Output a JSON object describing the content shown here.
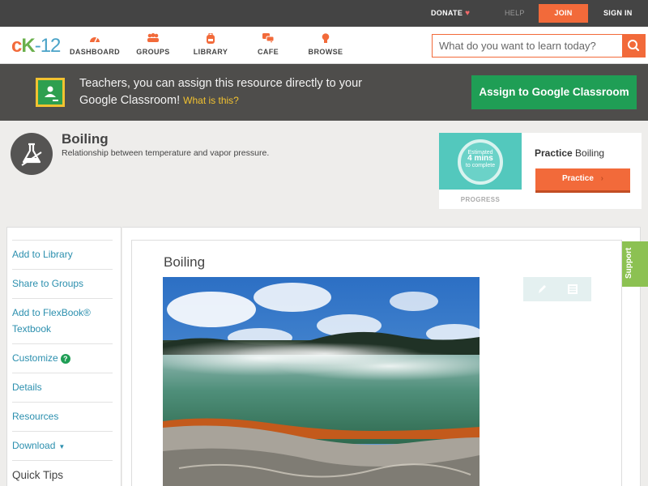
{
  "topbar": {
    "donate": "DONATE",
    "help": "HELP",
    "join": "JOIN",
    "signin": "SIGN IN"
  },
  "nav": {
    "logo": {
      "c": "c",
      "k": "K",
      "n": "-12"
    },
    "items": [
      {
        "label": "DASHBOARD",
        "icon": "dashboard-gauge-icon"
      },
      {
        "label": "GROUPS",
        "icon": "groups-people-icon"
      },
      {
        "label": "LIBRARY",
        "icon": "library-backpack-icon"
      },
      {
        "label": "CAFE",
        "icon": "cafe-chat-bubbles-icon"
      },
      {
        "label": "BROWSE",
        "icon": "browse-lightbulb-icon"
      }
    ],
    "search_placeholder": "What do you want to learn today?"
  },
  "banner": {
    "message": "Teachers, you can assign this resource directly to your Google Classroom!",
    "what_link": "What is this?",
    "assign_button": "Assign to Google Classroom"
  },
  "concept": {
    "title": "Boiling",
    "subtitle": "Relationship between temperature and vapor pressure."
  },
  "practice_card": {
    "estimated": "Estimated",
    "mins": "4 mins",
    "to_complete": "to complete",
    "progress_label": "PROGRESS",
    "practice_word": "Practice",
    "practice_topic": "Boiling",
    "practice_button": "Practice"
  },
  "sidebar": {
    "items": [
      "Add to Library",
      "Share to Groups",
      "Add to FlexBook® Textbook",
      "Customize",
      "Details",
      "Resources",
      "Download",
      "Quick Tips"
    ],
    "customize_help": "?"
  },
  "main": {
    "title": "Boiling"
  },
  "support": "Support",
  "colors": {
    "accent_orange": "#f26a3a",
    "topbar_bg": "#444444",
    "banner_bg": "#4e4d4b",
    "google_green": "#1f9e55",
    "teal": "#53c8bd",
    "support_green": "#8cc152",
    "link_blue": "#2b8fae"
  }
}
